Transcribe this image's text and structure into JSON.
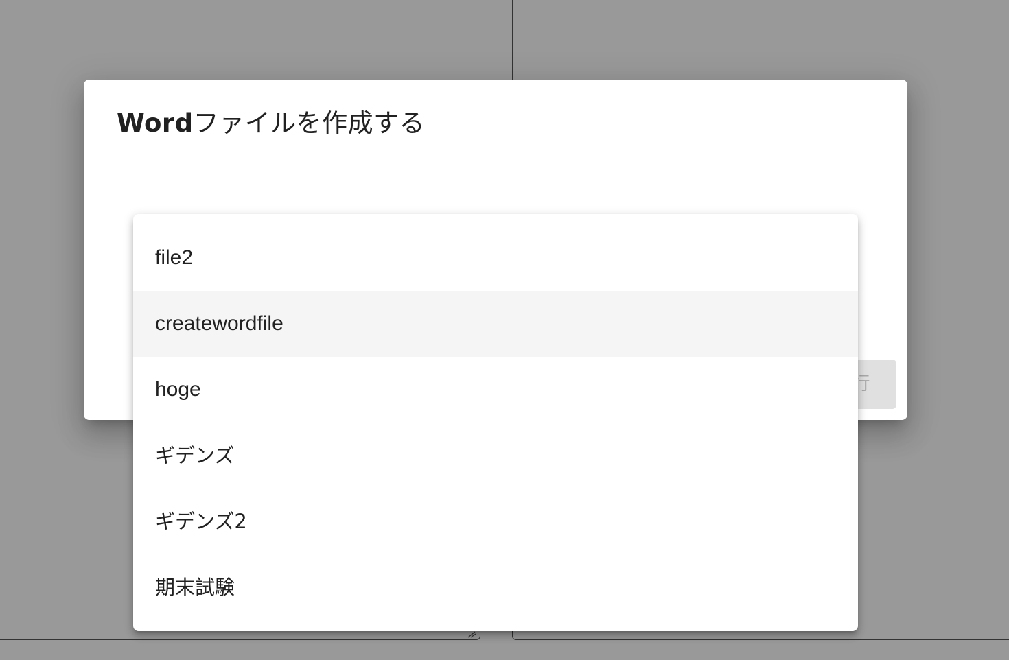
{
  "dialog": {
    "title_latin": "Word",
    "title_rest": "ファイルを作成する",
    "execute_button_label": "行"
  },
  "dropdown": {
    "items": [
      {
        "label": "file2",
        "highlighted": false
      },
      {
        "label": "createwordfile",
        "highlighted": true
      },
      {
        "label": "hoge",
        "highlighted": false
      },
      {
        "label": "ギデンズ",
        "highlighted": false
      },
      {
        "label": "ギデンズ2",
        "highlighted": false
      },
      {
        "label": "期末試験",
        "highlighted": false
      }
    ]
  },
  "colors": {
    "overlay": "rgba(0,0,0,0.40)",
    "dialog_bg": "#ffffff",
    "highlight": "#f5f5f5",
    "text": "#212121",
    "disabled_button_bg": "#e0e0e0",
    "disabled_button_text": "#a8a8a8"
  }
}
